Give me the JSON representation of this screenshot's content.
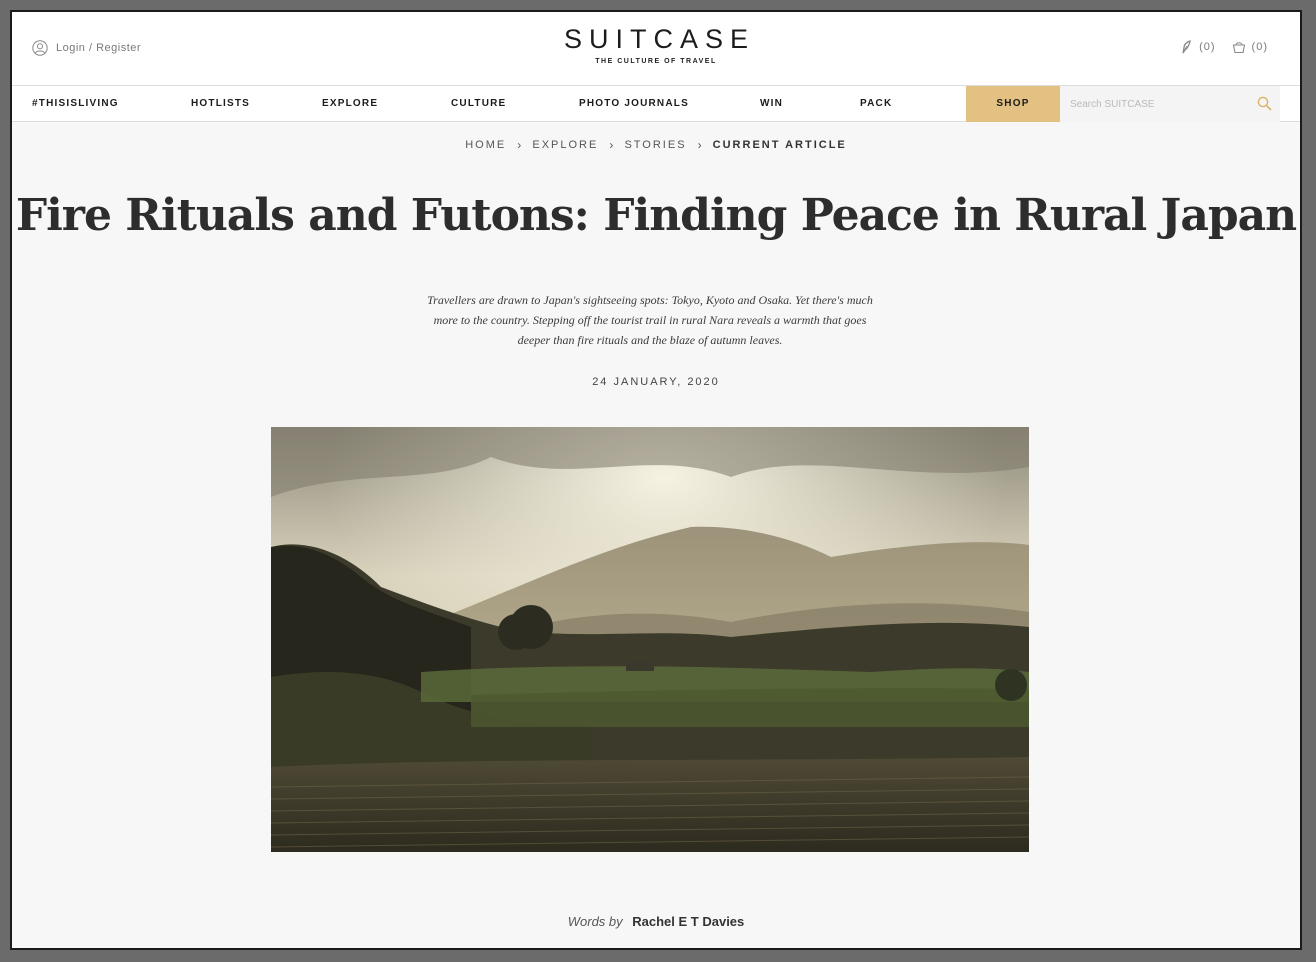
{
  "header": {
    "login_label": "Login / Register",
    "logo": "SUITCASE",
    "tagline": "THE CULTURE OF TRAVEL",
    "saved_count": "(0)",
    "basket_count": "(0)"
  },
  "nav": {
    "items": [
      {
        "label": "#THISISLIVING"
      },
      {
        "label": "HOTLISTS"
      },
      {
        "label": "EXPLORE"
      },
      {
        "label": "CULTURE"
      },
      {
        "label": "PHOTO JOURNALS"
      },
      {
        "label": "WIN"
      },
      {
        "label": "PACK"
      }
    ],
    "shop_label": "SHOP",
    "search_placeholder": "Search SUITCASE",
    "shop_color": "#e2c183"
  },
  "breadcrumb": {
    "items": [
      "HOME",
      "EXPLORE",
      "STORIES"
    ],
    "current": "CURRENT ARTICLE"
  },
  "article": {
    "title": "Fire Rituals and Futons: Finding Peace in Rural Japan",
    "standfirst": "Travellers are drawn to Japan's sightseeing spots: Tokyo, Kyoto and Osaka. Yet there's much more to the country. Stepping off the tourist trail in rural Nara reveals a warmth that goes deeper than fire rituals and the blaze of autumn leaves.",
    "date": "24 JANUARY, 2020",
    "byline_prefix": "Words by",
    "author": "Rachel E T Davies"
  }
}
